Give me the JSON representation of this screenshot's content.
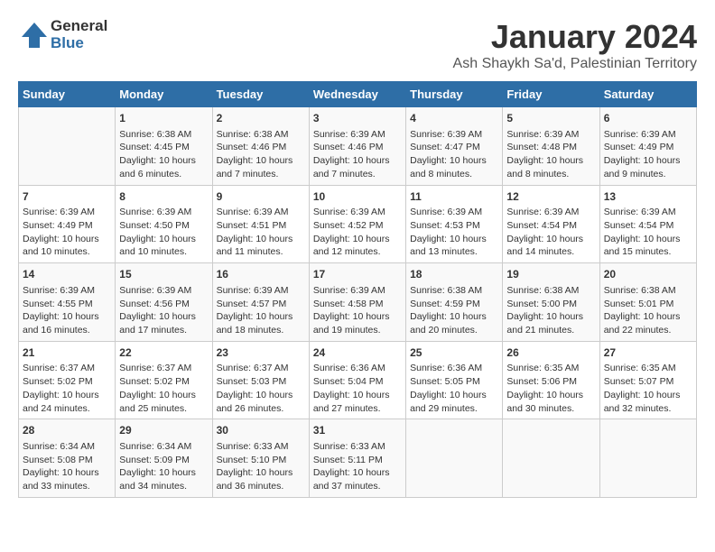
{
  "logo": {
    "general": "General",
    "blue": "Blue"
  },
  "title": "January 2024",
  "subtitle": "Ash Shaykh Sa'd, Palestinian Territory",
  "days_of_week": [
    "Sunday",
    "Monday",
    "Tuesday",
    "Wednesday",
    "Thursday",
    "Friday",
    "Saturday"
  ],
  "weeks": [
    [
      {
        "day": "",
        "info": ""
      },
      {
        "day": "1",
        "info": "Sunrise: 6:38 AM\nSunset: 4:45 PM\nDaylight: 10 hours\nand 6 minutes."
      },
      {
        "day": "2",
        "info": "Sunrise: 6:38 AM\nSunset: 4:46 PM\nDaylight: 10 hours\nand 7 minutes."
      },
      {
        "day": "3",
        "info": "Sunrise: 6:39 AM\nSunset: 4:46 PM\nDaylight: 10 hours\nand 7 minutes."
      },
      {
        "day": "4",
        "info": "Sunrise: 6:39 AM\nSunset: 4:47 PM\nDaylight: 10 hours\nand 8 minutes."
      },
      {
        "day": "5",
        "info": "Sunrise: 6:39 AM\nSunset: 4:48 PM\nDaylight: 10 hours\nand 8 minutes."
      },
      {
        "day": "6",
        "info": "Sunrise: 6:39 AM\nSunset: 4:49 PM\nDaylight: 10 hours\nand 9 minutes."
      }
    ],
    [
      {
        "day": "7",
        "info": "Sunrise: 6:39 AM\nSunset: 4:49 PM\nDaylight: 10 hours\nand 10 minutes."
      },
      {
        "day": "8",
        "info": "Sunrise: 6:39 AM\nSunset: 4:50 PM\nDaylight: 10 hours\nand 10 minutes."
      },
      {
        "day": "9",
        "info": "Sunrise: 6:39 AM\nSunset: 4:51 PM\nDaylight: 10 hours\nand 11 minutes."
      },
      {
        "day": "10",
        "info": "Sunrise: 6:39 AM\nSunset: 4:52 PM\nDaylight: 10 hours\nand 12 minutes."
      },
      {
        "day": "11",
        "info": "Sunrise: 6:39 AM\nSunset: 4:53 PM\nDaylight: 10 hours\nand 13 minutes."
      },
      {
        "day": "12",
        "info": "Sunrise: 6:39 AM\nSunset: 4:54 PM\nDaylight: 10 hours\nand 14 minutes."
      },
      {
        "day": "13",
        "info": "Sunrise: 6:39 AM\nSunset: 4:54 PM\nDaylight: 10 hours\nand 15 minutes."
      }
    ],
    [
      {
        "day": "14",
        "info": "Sunrise: 6:39 AM\nSunset: 4:55 PM\nDaylight: 10 hours\nand 16 minutes."
      },
      {
        "day": "15",
        "info": "Sunrise: 6:39 AM\nSunset: 4:56 PM\nDaylight: 10 hours\nand 17 minutes."
      },
      {
        "day": "16",
        "info": "Sunrise: 6:39 AM\nSunset: 4:57 PM\nDaylight: 10 hours\nand 18 minutes."
      },
      {
        "day": "17",
        "info": "Sunrise: 6:39 AM\nSunset: 4:58 PM\nDaylight: 10 hours\nand 19 minutes."
      },
      {
        "day": "18",
        "info": "Sunrise: 6:38 AM\nSunset: 4:59 PM\nDaylight: 10 hours\nand 20 minutes."
      },
      {
        "day": "19",
        "info": "Sunrise: 6:38 AM\nSunset: 5:00 PM\nDaylight: 10 hours\nand 21 minutes."
      },
      {
        "day": "20",
        "info": "Sunrise: 6:38 AM\nSunset: 5:01 PM\nDaylight: 10 hours\nand 22 minutes."
      }
    ],
    [
      {
        "day": "21",
        "info": "Sunrise: 6:37 AM\nSunset: 5:02 PM\nDaylight: 10 hours\nand 24 minutes."
      },
      {
        "day": "22",
        "info": "Sunrise: 6:37 AM\nSunset: 5:02 PM\nDaylight: 10 hours\nand 25 minutes."
      },
      {
        "day": "23",
        "info": "Sunrise: 6:37 AM\nSunset: 5:03 PM\nDaylight: 10 hours\nand 26 minutes."
      },
      {
        "day": "24",
        "info": "Sunrise: 6:36 AM\nSunset: 5:04 PM\nDaylight: 10 hours\nand 27 minutes."
      },
      {
        "day": "25",
        "info": "Sunrise: 6:36 AM\nSunset: 5:05 PM\nDaylight: 10 hours\nand 29 minutes."
      },
      {
        "day": "26",
        "info": "Sunrise: 6:35 AM\nSunset: 5:06 PM\nDaylight: 10 hours\nand 30 minutes."
      },
      {
        "day": "27",
        "info": "Sunrise: 6:35 AM\nSunset: 5:07 PM\nDaylight: 10 hours\nand 32 minutes."
      }
    ],
    [
      {
        "day": "28",
        "info": "Sunrise: 6:34 AM\nSunset: 5:08 PM\nDaylight: 10 hours\nand 33 minutes."
      },
      {
        "day": "29",
        "info": "Sunrise: 6:34 AM\nSunset: 5:09 PM\nDaylight: 10 hours\nand 34 minutes."
      },
      {
        "day": "30",
        "info": "Sunrise: 6:33 AM\nSunset: 5:10 PM\nDaylight: 10 hours\nand 36 minutes."
      },
      {
        "day": "31",
        "info": "Sunrise: 6:33 AM\nSunset: 5:11 PM\nDaylight: 10 hours\nand 37 minutes."
      },
      {
        "day": "",
        "info": ""
      },
      {
        "day": "",
        "info": ""
      },
      {
        "day": "",
        "info": ""
      }
    ]
  ]
}
